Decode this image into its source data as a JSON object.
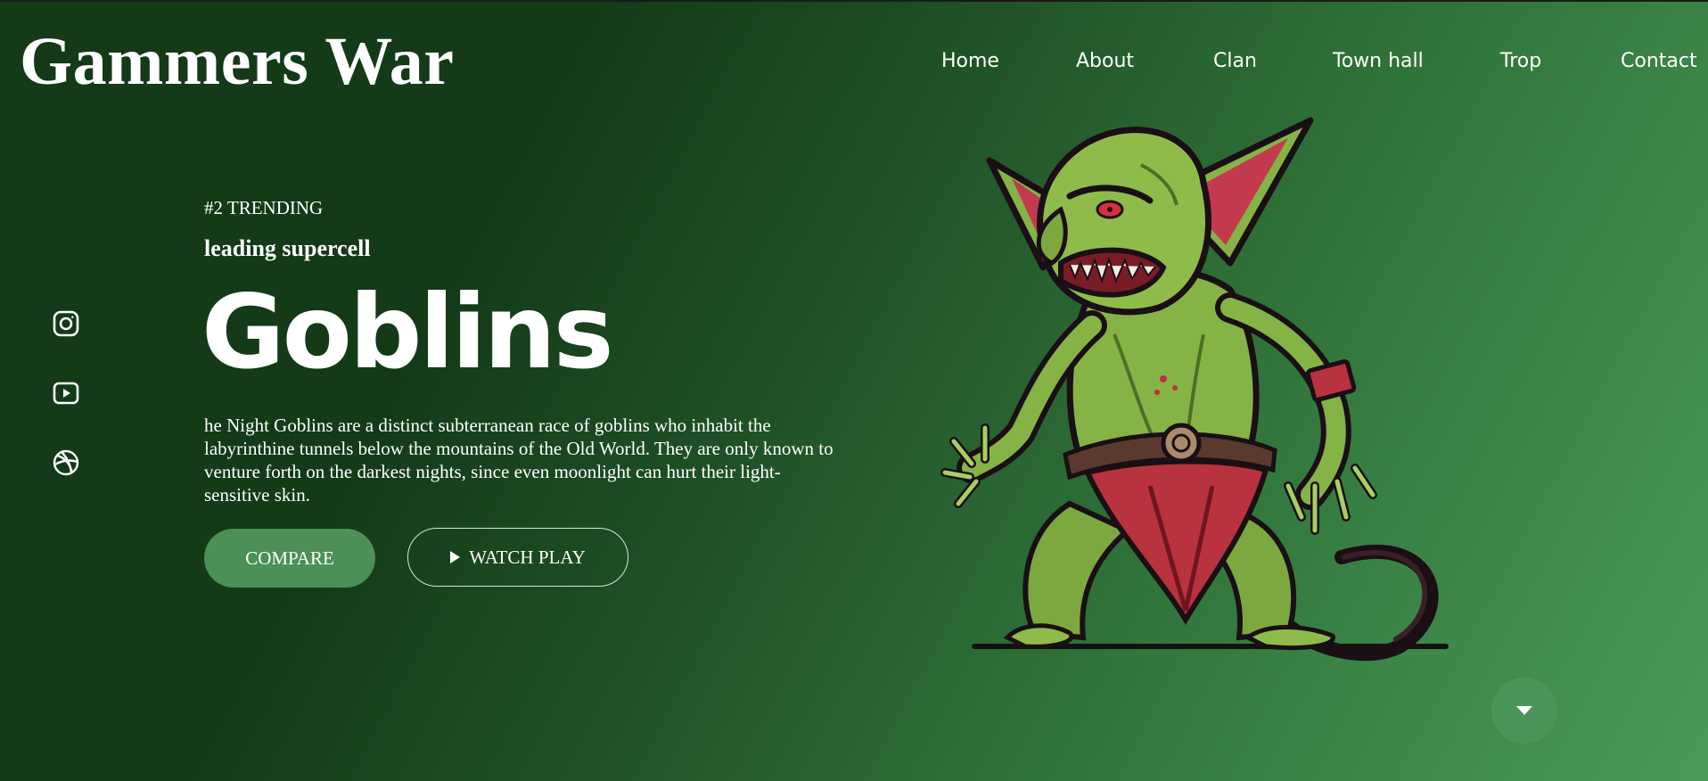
{
  "brand": {
    "logo_text": "Gammers War"
  },
  "nav": {
    "items": [
      {
        "label": "Home"
      },
      {
        "label": "About"
      },
      {
        "label": "Clan"
      },
      {
        "label": "Town hall"
      },
      {
        "label": "Trop"
      },
      {
        "label": "Contact"
      }
    ]
  },
  "social": {
    "icons": [
      "instagram-icon",
      "youtube-icon",
      "dribbble-icon"
    ]
  },
  "hero": {
    "trending": "#2 TRENDING",
    "subtitle": "leading supercell",
    "title": "Goblins",
    "description": "he Night Goblins are a distinct subterranean race of goblins who inhabit the labyrinthine tunnels below the mountains of the Old World. They are only known to venture forth on the darkest nights, since even moonlight can hurt their light-sensitive skin.",
    "compare_label": "COMPARE",
    "watch_label": "WATCH PLAY"
  },
  "colors": {
    "background_dark": "#143a18",
    "background_light": "#4b9a57",
    "button_green": "#4c8f57",
    "text": "#ffffff"
  }
}
